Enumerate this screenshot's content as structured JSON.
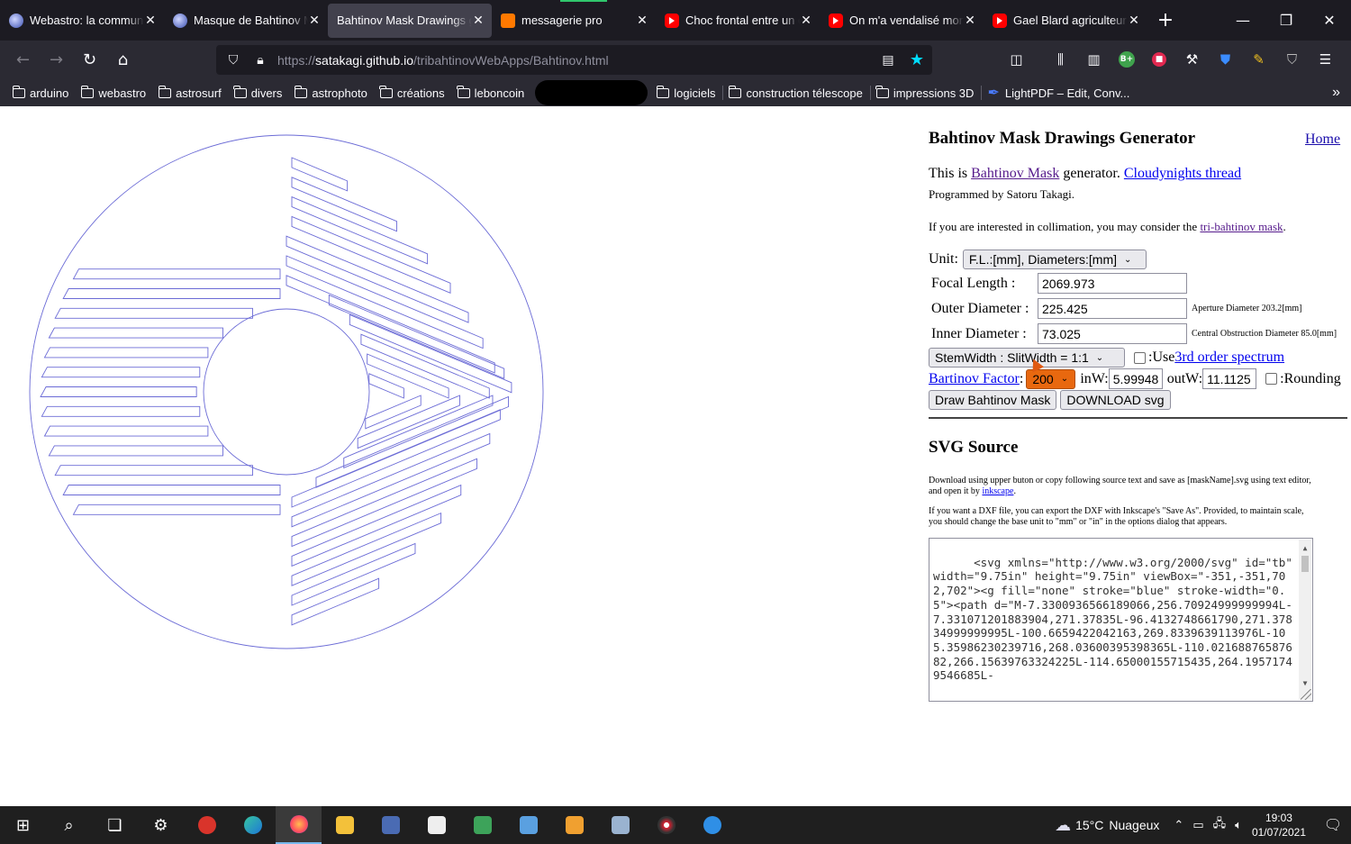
{
  "tabs": [
    {
      "title": "Webastro: la communauté",
      "icon": "astro-icon",
      "active": false
    },
    {
      "title": "Masque de Bahtinov Mask",
      "icon": "astro-icon",
      "active": false
    },
    {
      "title": "Bahtinov Mask Drawings generator",
      "icon": "none",
      "active": true
    },
    {
      "title": "messagerie pro",
      "icon": "orange-icon",
      "active": false
    },
    {
      "title": "Choc frontal entre un camion",
      "icon": "youtube-icon",
      "active": false
    },
    {
      "title": "On m'a vendalisé mon",
      "icon": "youtube-icon",
      "active": false
    },
    {
      "title": "Gael Blard agriculteur",
      "icon": "youtube-icon",
      "active": false
    }
  ],
  "url": {
    "prefix": "https://",
    "host": "satakagi.github.io",
    "path": "/tribahtinovWebApps/Bahtinov.html"
  },
  "bookmarks": [
    "arduino",
    "webastro",
    "astrosurf",
    "divers",
    "astrophoto",
    "créations",
    "leboncoin",
    "logiciels",
    "construction télescope",
    "impressions 3D"
  ],
  "bookmark_pdf": "LightPDF – Edit, Conv...",
  "panel": {
    "title": "Bahtinov Mask Drawings Generator",
    "home": "Home",
    "intro_prefix": "This is ",
    "intro_link1": "Bahtinov Mask",
    "intro_mid": " generator. ",
    "intro_link2": "Cloudynights thread",
    "byline": "Programmed by Satoru Takagi.",
    "colli_prefix": "If you are interested in collimation, you may consider the ",
    "colli_link": "tri-bahtinov mask",
    "colli_suffix": ".",
    "unit_label": "Unit:",
    "unit_value": "F.L.:[mm], Diameters:[mm]",
    "focal_label": "Focal Length :",
    "focal_value": "2069.973",
    "outer_label": "Outer Diameter :",
    "outer_value": "225.425",
    "outer_note": "Aperture Diameter 203.2[mm]",
    "inner_label": "Inner Diameter :",
    "inner_value": "73.025",
    "inner_note": "Central Obstruction Diameter 85.0[mm]",
    "stem_value": "StemWidth : SlitWidth = 1:1",
    "use_label": ":Use ",
    "use_link": "3rd order spectrum",
    "factor_link": "Bartinov Factor",
    "factor_colon": ":",
    "factor_value": "200",
    "inw_label": "inW:",
    "inw_value": "5.99948",
    "outw_label": "outW:",
    "outw_value": "11.1125",
    "rounding_label": ":Rounding",
    "draw_btn": "Draw Bahtinov Mask",
    "download_btn": "DOWNLOAD svg",
    "svg_title": "SVG Source",
    "note1_a": "Download using upper buton or copy following source text and save as [maskName].svg using text editor, and open it by ",
    "note1_link": "inkscape",
    "note1_b": ".",
    "note2": "If you want a DXF file, you can export the DXF with Inkscape's \"Save As\". Provided, to maintain scale, you should change the base unit to \"mm\" or \"in\" in the options dialog that appears.",
    "source": "<svg xmlns=\"http://www.w3.org/2000/svg\" id=\"tb\" width=\"9.75in\" height=\"9.75in\" viewBox=\"-351,-351,702,702\"><g fill=\"none\" stroke=\"blue\" stroke-width=\"0.5\"><path d=\"M-7.3300936566189066,256.70924999999994L-7.331071201883904,271.37835L-96.4132748661790,271.37834999999995L-100.6659422042163,269.8339639113976L-105.35986230239716,268.03600395398365L-110.02168876587682,266.15639763324225L-114.65000155715435,264.19571749546685L-"
  },
  "taskbar": {
    "weather_temp": "15°C",
    "weather_desc": "Nuageux",
    "time": "19:03",
    "date": "01/07/2021"
  },
  "colors": {
    "mask_stroke": "#6b6bd6",
    "factor_bg": "#e8680f",
    "link": "#551a8b"
  }
}
